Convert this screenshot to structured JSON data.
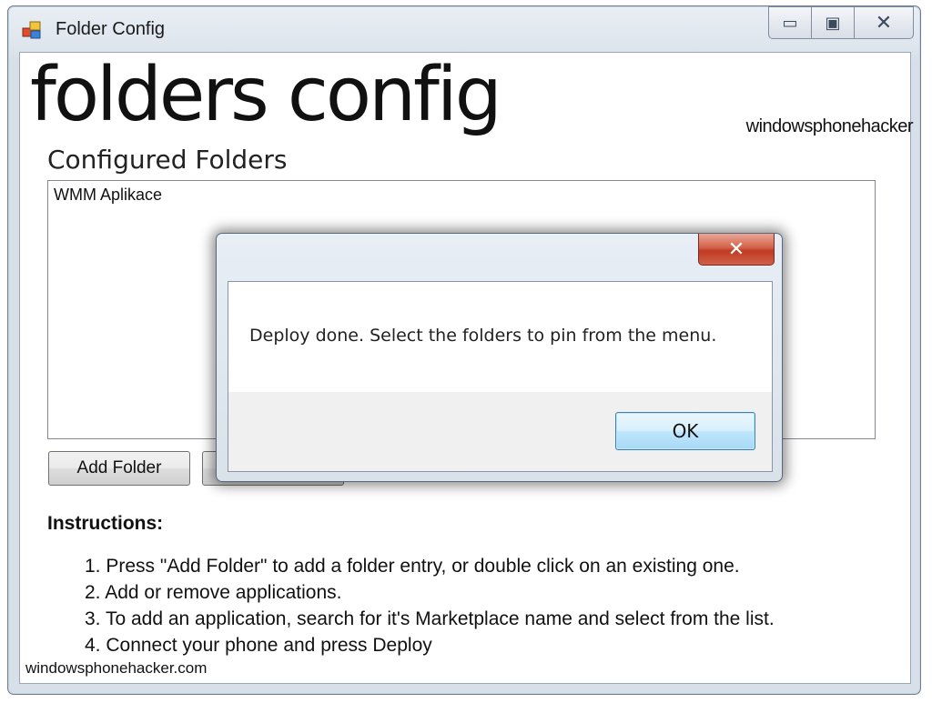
{
  "window": {
    "title": "Folder Config",
    "icon": "app-window-icon",
    "caption_buttons": {
      "minimize": "▭",
      "maximize": "▣",
      "close": "✕"
    }
  },
  "header": {
    "title": "folders config",
    "brand": "windowsphonehacker"
  },
  "folders": {
    "section_title": "Configured Folders",
    "items": [
      "WMM Aplikace"
    ]
  },
  "buttons": {
    "add_folder": "Add Folder"
  },
  "instructions": {
    "title": "Instructions:",
    "steps": [
      "1. Press \"Add Folder\" to add a folder entry, or double click on an existing one.",
      "2. Add or remove applications.",
      "3. To add an application, search for it's Marketplace name and select from the list.",
      "4. Connect your phone and press Deploy"
    ]
  },
  "footer": {
    "link": "windowsphonehacker.com"
  },
  "dialog": {
    "close_glyph": "✕",
    "message": "Deploy done. Select the folders to pin from the menu.",
    "ok_label": "OK"
  },
  "colors": {
    "dialog_close": "#c13a22",
    "ok_button_border": "#3c7fb1",
    "window_frame": "#dfe6ee"
  }
}
